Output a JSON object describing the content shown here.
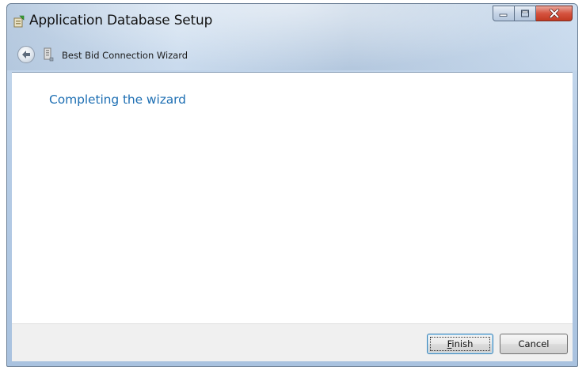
{
  "window": {
    "title": "Application Database Setup",
    "icons": {
      "app": "setup-app-icon",
      "minimize": "minimize-icon",
      "maximize": "maximize-icon",
      "close": "close-icon"
    },
    "colors": {
      "close_button": "#c94a33",
      "frame": "#b7cde6"
    }
  },
  "navbar": {
    "back_icon": "back-arrow-icon",
    "wizard_icon": "wizard-page-icon",
    "wizard_title": "Best Bid Connection Wizard"
  },
  "content": {
    "heading": "Completing the wizard",
    "heading_color": "#1e6fb3"
  },
  "footer": {
    "finish": {
      "mnemonic": "F",
      "rest": "inish"
    },
    "cancel_label": "Cancel"
  }
}
